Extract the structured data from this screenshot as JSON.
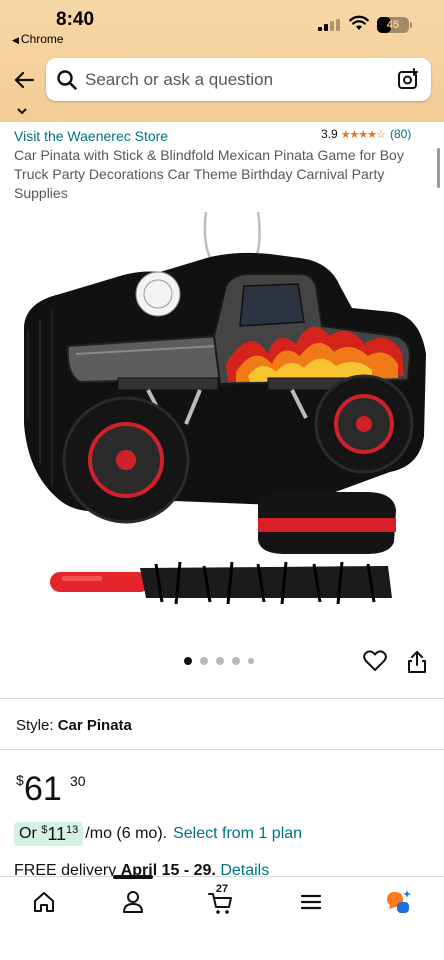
{
  "status_bar": {
    "time": "8:40",
    "back_app": "Chrome",
    "battery": "45",
    "battery_level": 0.45
  },
  "search": {
    "placeholder": "Search or ask a question"
  },
  "product": {
    "store_link": "Visit the Waenerec Store",
    "rating_value": "3.9",
    "rating_stars": "★★★★☆",
    "rating_count": "(80)",
    "title": "Car Pinata with Stick & Blindfold Mexican Pinata Game for Boy Truck Party Decorations Car Theme Birthday Carnival Party Supplies"
  },
  "gallery": {
    "image_count": 5,
    "active_index": 0
  },
  "style": {
    "label": "Style:",
    "value": "Car Pinata"
  },
  "price": {
    "symbol": "$",
    "whole": "61",
    "fraction": "30"
  },
  "plan": {
    "prefix": "Or",
    "symbol": "$",
    "whole": "11",
    "fraction": "13",
    "per": "/mo (6 mo).",
    "select_link": "Select from 1 plan"
  },
  "delivery": {
    "prefix": "FREE delivery",
    "dates": "April 15 - 29.",
    "details_link": "Details"
  },
  "tabbar": {
    "cart_count": "27",
    "active_tab": "account"
  },
  "colors": {
    "header_bg": "#f4cc95",
    "link": "#007185",
    "star": "#de7921",
    "plan_highlight": "#d7f0e4"
  }
}
